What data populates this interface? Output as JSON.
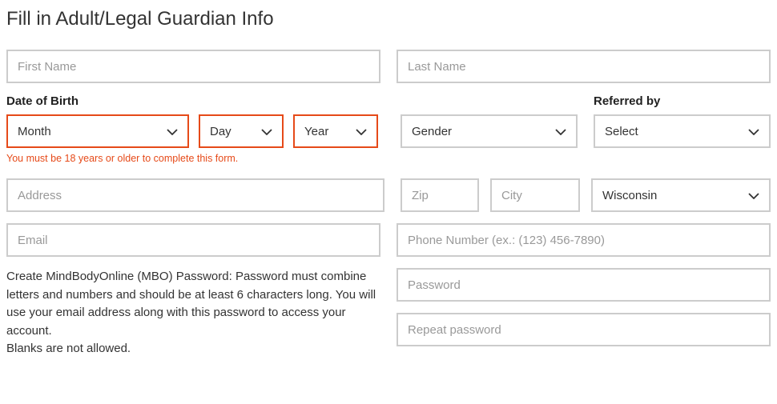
{
  "title": "Fill in Adult/Legal Guardian Info",
  "fields": {
    "first_name_placeholder": "First Name",
    "last_name_placeholder": "Last Name",
    "dob_label": "Date of Birth",
    "month_text": "Month",
    "day_text": "Day",
    "year_text": "Year",
    "age_error": "You must be 18 years or older to complete this form.",
    "gender_text": "Gender",
    "referred_label": "Referred by",
    "referred_text": "Select",
    "address_placeholder": "Address",
    "zip_placeholder": "Zip",
    "city_placeholder": "City",
    "state_text": "Wisconsin",
    "email_placeholder": "Email",
    "phone_placeholder": "Phone Number (ex.: (123) 456-7890)",
    "password_info_line1": "Create MindBodyOnline (MBO) Password: Password must combine letters and numbers and should be at least 6 characters long. You will use your email address along with this password to access your account.",
    "password_info_line2": "Blanks are not allowed.",
    "password_placeholder": "Password",
    "repeat_password_placeholder": "Repeat password"
  }
}
